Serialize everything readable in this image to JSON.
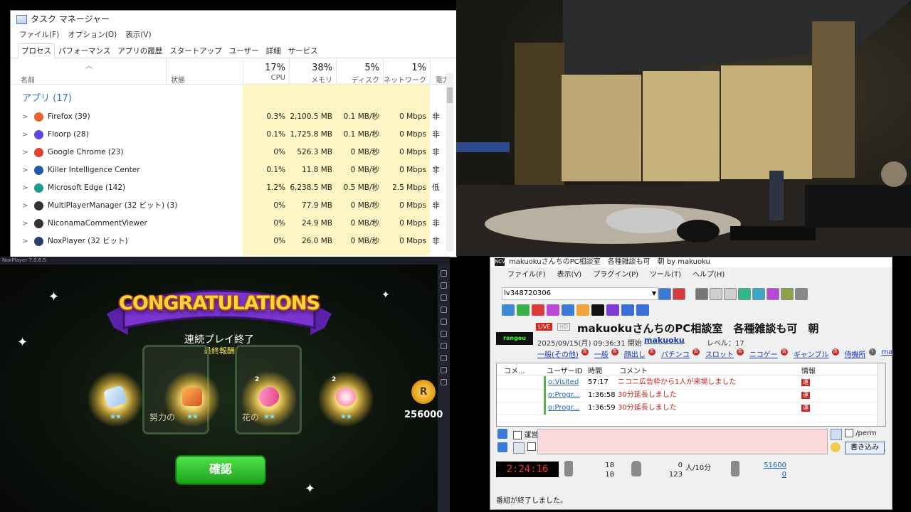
{
  "task_manager": {
    "title": "タスク マネージャー",
    "menu": [
      "ファイル(F)",
      "オプション(O)",
      "表示(V)"
    ],
    "tabs": [
      "プロセス",
      "パフォーマンス",
      "アプリの履歴",
      "スタートアップ",
      "ユーザー",
      "詳細",
      "サービス"
    ],
    "columns": {
      "name": "名前",
      "status": "状態",
      "cpu_pct": "17%",
      "cpu": "CPU",
      "mem_pct": "38%",
      "mem": "メモリ",
      "disk_pct": "5%",
      "disk": "ディスク",
      "net_pct": "1%",
      "net": "ネットワーク",
      "power": "電力"
    },
    "group": "アプリ (17)",
    "rows": [
      {
        "name": "Firefox (39)",
        "cpu": "0.3%",
        "mem": "2,100.5 MB",
        "disk": "0.1 MB/秒",
        "net": "0 Mbps",
        "power": "非",
        "color": "#e8642c"
      },
      {
        "name": "Floorp (28)",
        "cpu": "0.1%",
        "mem": "1,725.8 MB",
        "disk": "0.1 MB/秒",
        "net": "0 Mbps",
        "power": "非",
        "color": "#5a48d6"
      },
      {
        "name": "Google Chrome (23)",
        "cpu": "0%",
        "mem": "526.3 MB",
        "disk": "0 MB/秒",
        "net": "0 Mbps",
        "power": "非",
        "color": "#e3402d"
      },
      {
        "name": "Killer Intelligence Center",
        "cpu": "0.1%",
        "mem": "11.8 MB",
        "disk": "0 MB/秒",
        "net": "0 Mbps",
        "power": "非",
        "color": "#1e5aa8"
      },
      {
        "name": "Microsoft Edge (142)",
        "cpu": "1.2%",
        "mem": "6,238.5 MB",
        "disk": "0.5 MB/秒",
        "net": "2.5 Mbps",
        "power": "低",
        "color": "#1b9c8c"
      },
      {
        "name": "MultiPlayerManager (32 ビット) (3)",
        "cpu": "0%",
        "mem": "77.9 MB",
        "disk": "0 MB/秒",
        "net": "0 Mbps",
        "power": "非",
        "color": "#333333"
      },
      {
        "name": "NiconamaCommentViewer",
        "cpu": "0%",
        "mem": "24.9 MB",
        "disk": "0 MB/秒",
        "net": "0 Mbps",
        "power": "非",
        "color": "#333333"
      },
      {
        "name": "NoxPlayer (32 ビット)",
        "cpu": "0%",
        "mem": "26.0 MB",
        "disk": "0 MB/秒",
        "net": "0 Mbps",
        "power": "非",
        "color": "#2a3e66"
      }
    ]
  },
  "game": {
    "window_title": "NoxPlayer 7.0.6.5",
    "banner": "CONGRATULATIONS",
    "subtitle": "連続プレイ終了",
    "subtitle2": "最終報酬",
    "items": [
      {
        "stars": "★★",
        "count": ""
      },
      {
        "stars": "★★",
        "count": ""
      },
      {
        "stars": "★★",
        "count": "2"
      },
      {
        "stars": "★★",
        "count": "2"
      }
    ],
    "bg_label1": "努力の",
    "bg_label2": "花の",
    "coin_letter": "R",
    "coin_value": "256000",
    "confirm_button": "確認"
  },
  "comment_viewer": {
    "window_title": "makuokuさんちのPC相談室　各種雑談も可　朝 by makuoku",
    "menu": [
      "ファイル(F)",
      "表示(V)",
      "プラグイン(P)",
      "ツール(T)",
      "ヘルプ(H)"
    ],
    "live_id": "lv348720306",
    "live_badge": "LIVE",
    "hd_badge": "HD",
    "logo_text": "rengou",
    "program_title": "makuokuさんちのPC相談室　各種雑談も可　朝",
    "program_date": "2025/09/15(月) 09:36:31 開始",
    "owner": "makuoku",
    "level": "レベル：17",
    "categories": [
      "一般(その他)",
      "一般",
      "顔出し",
      "パチンコ",
      "スロット",
      "ニコゲー",
      "ギャンブル",
      "侍機所",
      "ma"
    ],
    "grid_headers": {
      "no": "コメ...",
      "uid": "ユーザーID",
      "time": "時間",
      "comment": "コメント",
      "info": "情報"
    },
    "comments": [
      {
        "uid": "o:Visited",
        "time": "57:17",
        "comment": "ニコニ広告枠から1人が来場しました",
        "info": "運"
      },
      {
        "uid": "o:Progr...",
        "time": "1:36:58",
        "comment": "30分延長しました",
        "info": "運"
      },
      {
        "uid": "o:Progr...",
        "time": "1:36:59",
        "comment": "30分延長しました",
        "info": "運"
      }
    ],
    "unei_label": "運営",
    "perm_label": "/perm",
    "write_button": "書き込み",
    "elapsed": "2:24:16",
    "stat_a1": "18",
    "stat_a2": "18",
    "stat_b1": "0",
    "stat_b_unit": "人/10分",
    "stat_b2": "123",
    "stat_c1": "51600",
    "stat_c2": "0",
    "status": "番組が終了しました。"
  }
}
